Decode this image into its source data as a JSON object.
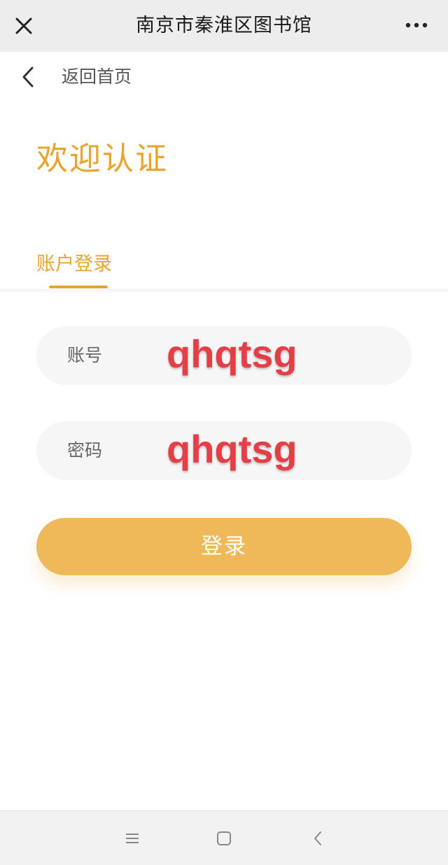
{
  "topbar": {
    "title": "南京市秦淮区图书馆",
    "close_icon": "close-icon",
    "more_icon": "more-icon"
  },
  "back": {
    "label": "返回首页",
    "icon": "chevron-left-icon"
  },
  "welcome_title": "欢迎认证",
  "tabs": [
    {
      "label": "账户登录",
      "active": true
    }
  ],
  "form": {
    "account": {
      "label": "账号",
      "value": "qhqtsg"
    },
    "password": {
      "label": "密码",
      "value": "qhqtsg"
    },
    "submit_label": "登录"
  },
  "bottom_nav": {
    "icons": [
      "menu-icon",
      "home-square-icon",
      "back-icon"
    ]
  },
  "colors": {
    "accent": "#e7a52f",
    "button": "#efb95a",
    "overlay_text": "#e53e46",
    "topbar_bg": "#ededed"
  }
}
